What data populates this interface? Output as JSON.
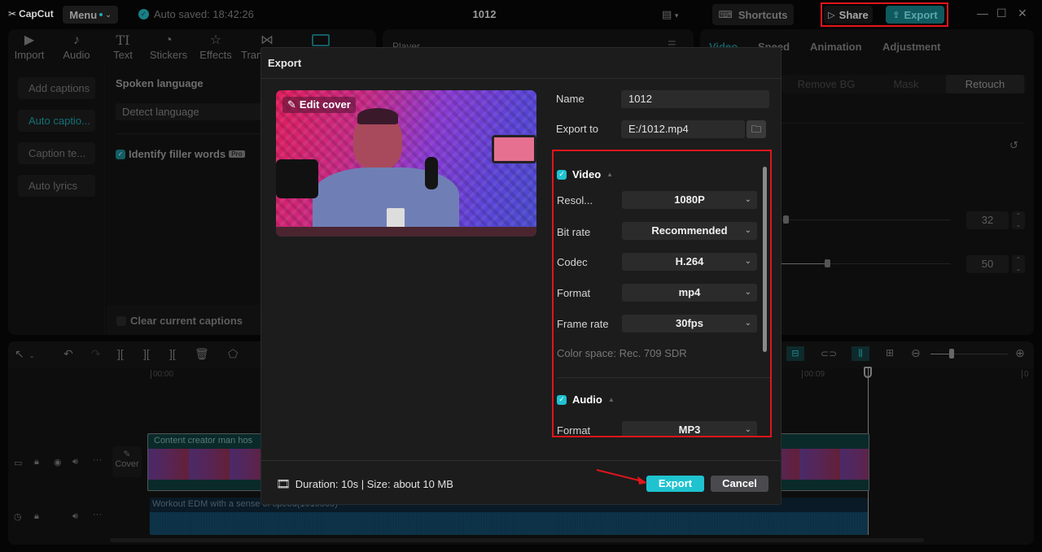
{
  "titlebar": {
    "app_name": "CapCut",
    "menu_label": "Menu",
    "autosave_text": "Auto saved: 18:42:26",
    "project_title": "1012",
    "shortcuts_label": "Shortcuts",
    "share_label": "Share",
    "export_label": "Export"
  },
  "media_toolbar": [
    {
      "label": "Import",
      "icon": "import-icon"
    },
    {
      "label": "Audio",
      "icon": "audio-icon"
    },
    {
      "label": "Text",
      "icon": "text-icon"
    },
    {
      "label": "Stickers",
      "icon": "stickers-icon"
    },
    {
      "label": "Effects",
      "icon": "effects-icon"
    },
    {
      "label": "Tran",
      "icon": "transitions-icon"
    }
  ],
  "captions_sidebar": [
    {
      "label": "Add captions",
      "active": false
    },
    {
      "label": "Auto captio...",
      "active": true
    },
    {
      "label": "Caption te...",
      "active": false
    },
    {
      "label": "Auto lyrics",
      "active": false
    }
  ],
  "captions_panel": {
    "spoken_language_label": "Spoken language",
    "language_value": "Detect language",
    "filler_words_label": "Identify filler words",
    "filler_words_checked": true,
    "pro_badge": "Pro",
    "clear_captions_label": "Clear current captions",
    "clear_captions_checked": false
  },
  "player": {
    "title": "Player"
  },
  "inspector": {
    "tabs": [
      "Video",
      "Speed",
      "Animation",
      "Adjustment"
    ],
    "active_tab": "Video",
    "subtabs": [
      "Remove BG",
      "Mask",
      "Retouch"
    ],
    "active_subtab": "Retouch",
    "sliders": [
      {
        "value": "32",
        "fraction": 0.0
      },
      {
        "value": "50",
        "fraction": 0.25
      }
    ]
  },
  "timeline": {
    "ruler": [
      "00:00",
      "00:09",
      "0"
    ],
    "cover_label": "Cover",
    "video_clip_title": "Content creator man hos",
    "audio_clip_title": "Workout EDM with a sense of speed(1010505)",
    "zoom_fraction": 0.3
  },
  "export_dialog": {
    "title": "Export",
    "edit_cover_label": "Edit cover",
    "name_label": "Name",
    "name_value": "1012",
    "export_to_label": "Export to",
    "export_to_value": "E:/1012.mp4",
    "video_section": {
      "label": "Video",
      "checked": true,
      "rows": [
        {
          "label": "Resol...",
          "value": "1080P"
        },
        {
          "label": "Bit rate",
          "value": "Recommended"
        },
        {
          "label": "Codec",
          "value": "H.264"
        },
        {
          "label": "Format",
          "value": "mp4"
        },
        {
          "label": "Frame rate",
          "value": "30fps"
        }
      ],
      "color_space": "Color space: Rec. 709 SDR"
    },
    "audio_section": {
      "label": "Audio",
      "checked": true,
      "rows": [
        {
          "label": "Format",
          "value": "MP3"
        }
      ]
    },
    "footer_info": "Duration: 10s | Size: about 10 MB",
    "export_button": "Export",
    "cancel_button": "Cancel"
  },
  "colors": {
    "accent": "#1ec3cf",
    "highlight_box": "#e0151b",
    "modal_bg": "#1c1c1c"
  }
}
